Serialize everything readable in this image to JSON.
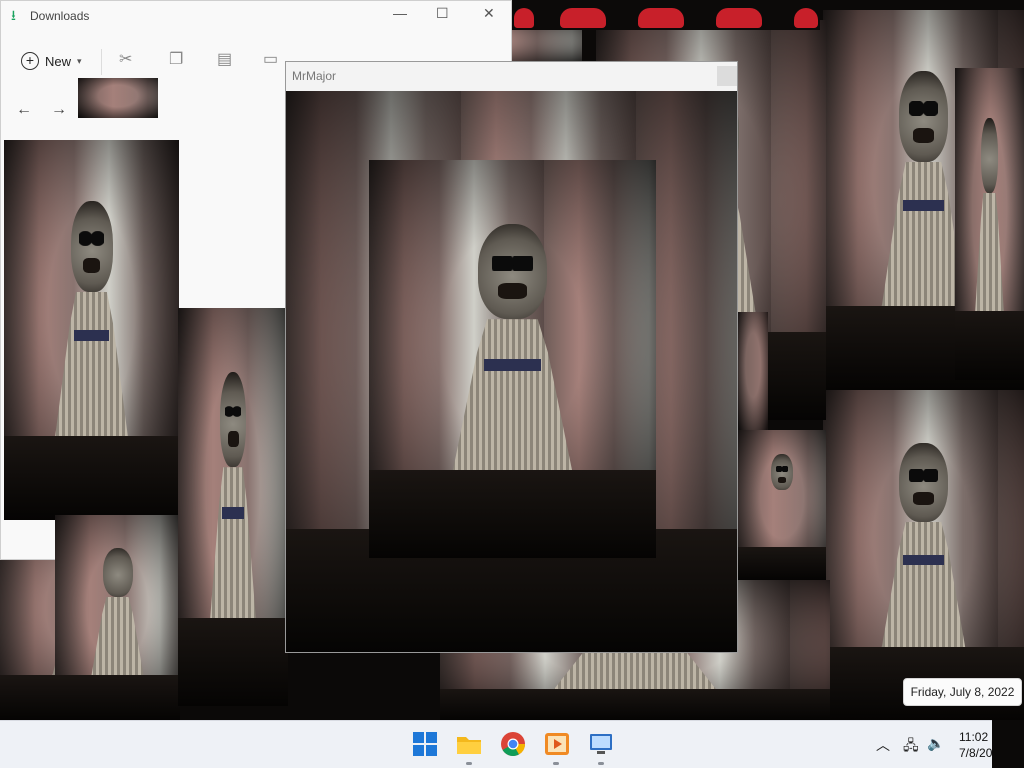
{
  "explorer": {
    "title": "Downloads",
    "new_label": "New",
    "back_icon": "arrow-left-icon",
    "forward_icon": "arrow-right-icon"
  },
  "popup": {
    "title": "MrMajor"
  },
  "tooltip": {
    "text": "Friday, July 8, 2022"
  },
  "taskbar": {
    "apps": [
      "windows-start-icon",
      "file-explorer-icon",
      "chrome-icon",
      "media-player-icon",
      "remote-desktop-icon"
    ],
    "time": "11:02",
    "date": "7/8/20"
  },
  "colors": {
    "taskbar_bg": "#eef1f6",
    "accent_green": "#1aa35f",
    "heart_red": "#c8202a"
  }
}
